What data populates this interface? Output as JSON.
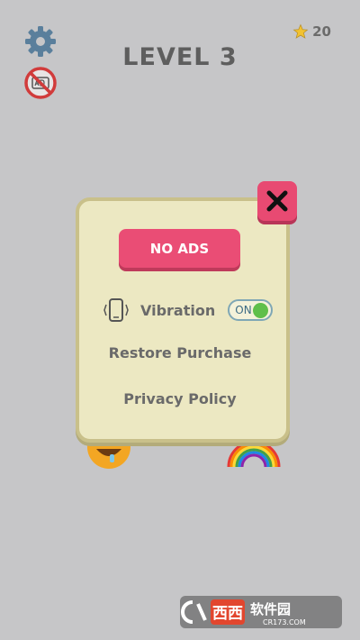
{
  "header": {
    "level_title": "LEVEL 3",
    "star_count": "20"
  },
  "dialog": {
    "no_ads_label": "NO ADS",
    "vibration_label": "Vibration",
    "vibration_toggle_text": "ON",
    "restore_label": "Restore Purchase",
    "privacy_label": "Privacy Policy"
  },
  "watermark": {
    "brand_text": "西西软件园",
    "site_text": "CR173.COM"
  },
  "icons": {
    "settings": "gear-icon",
    "no_ads": "no-ads-icon",
    "star": "star-icon",
    "close": "close-icon",
    "vibration": "phone-vibrate-icon"
  },
  "colors": {
    "background": "#c6c6c8",
    "dialog_bg": "#ece8c2",
    "accent_pink": "#ea4d75",
    "toggle_on": "#5fbf4a"
  }
}
